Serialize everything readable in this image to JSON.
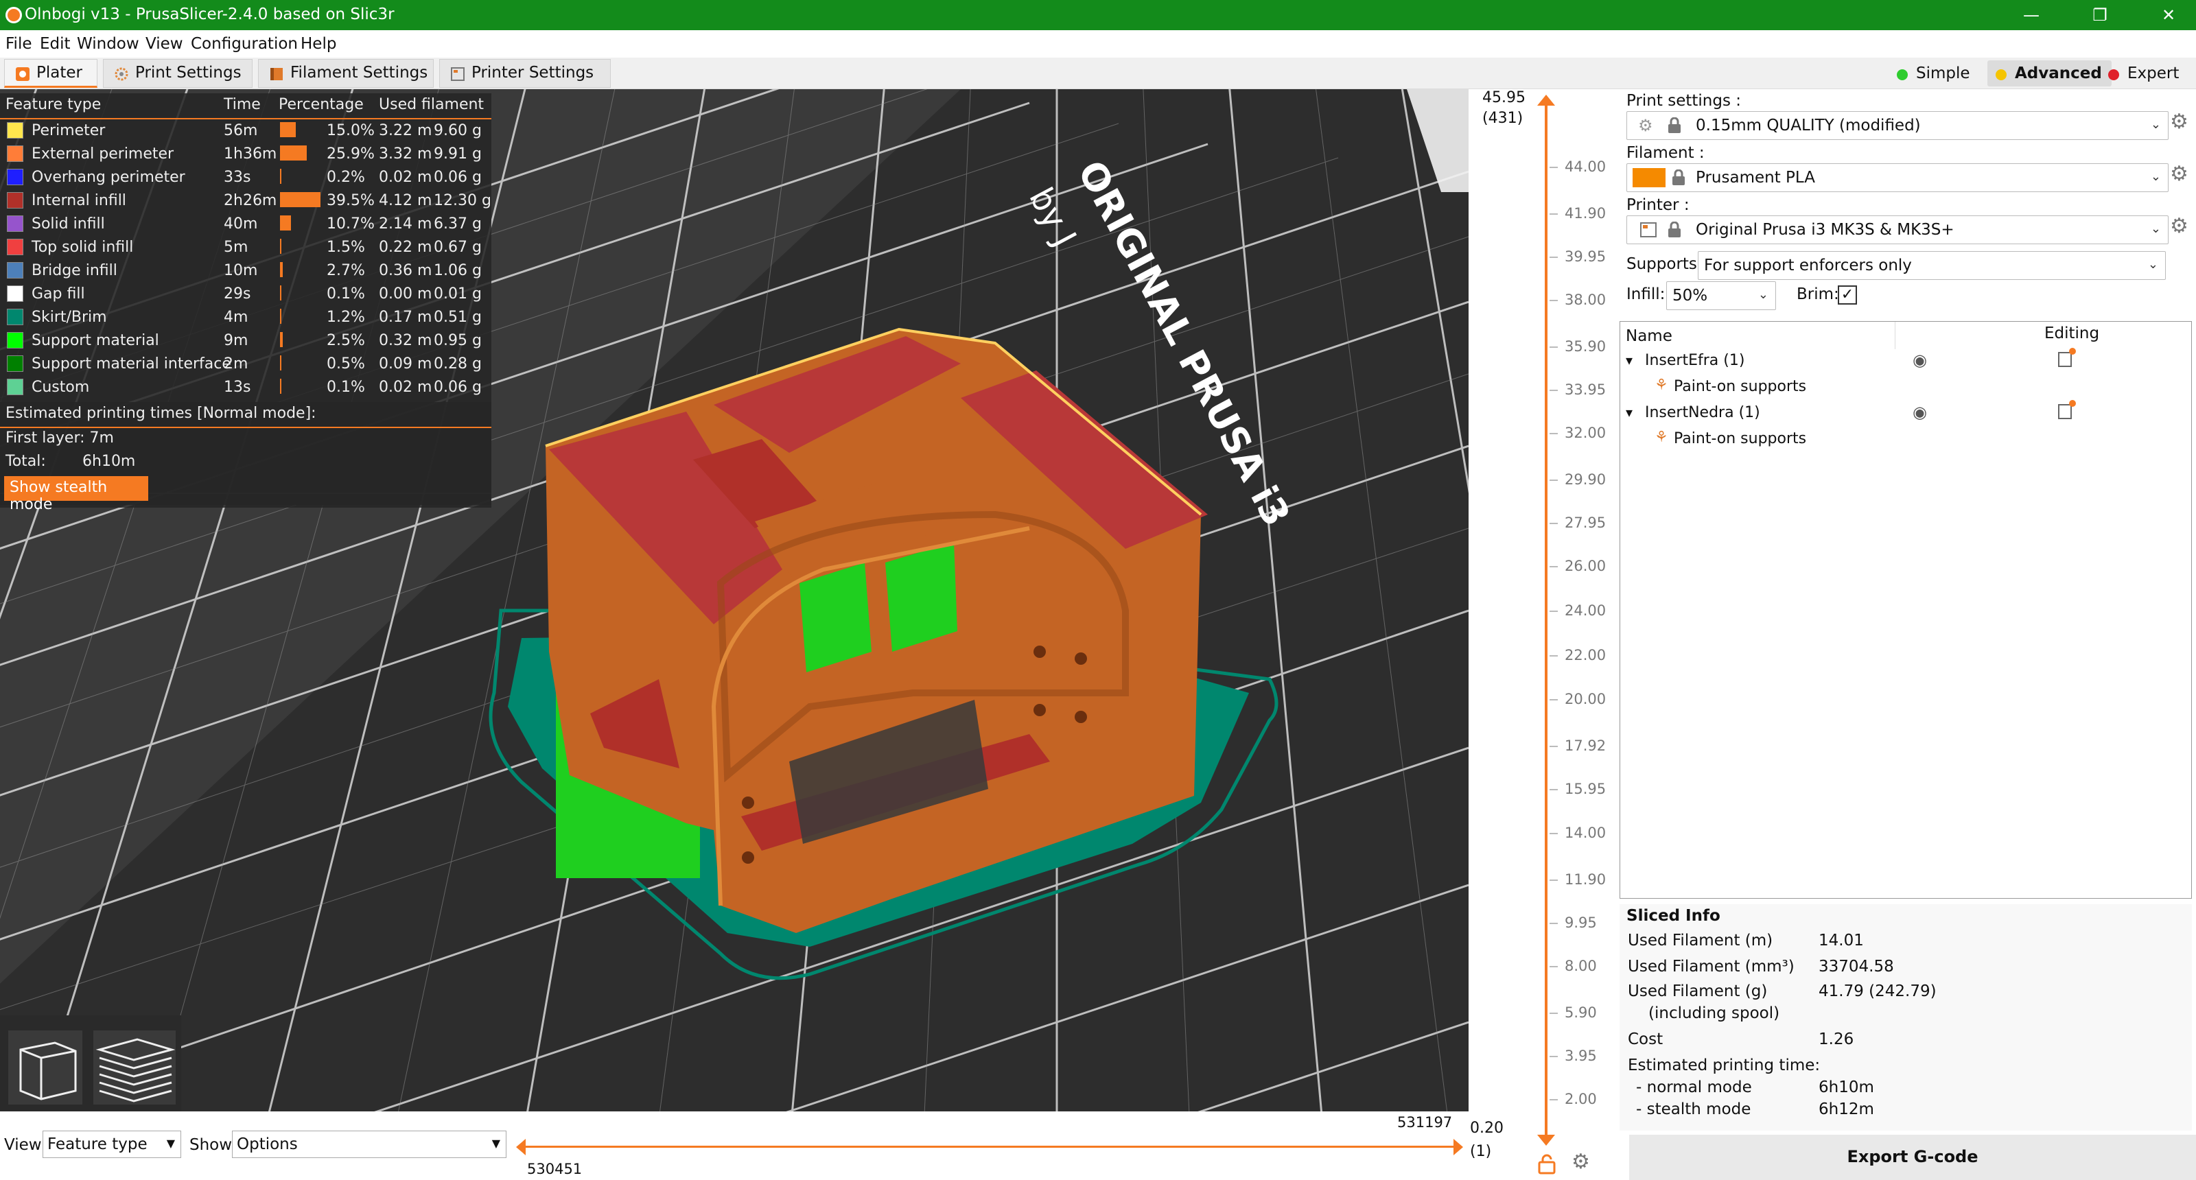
{
  "window": {
    "title": "Olnbogi v13 - PrusaSlicer-2.4.0 based on Slic3r",
    "minimize": "—",
    "restore": "❐",
    "close": "✕"
  },
  "menu": [
    "File",
    "Edit",
    "Window",
    "View",
    "Configuration",
    "Help"
  ],
  "tabs": [
    "Plater",
    "Print Settings",
    "Filament Settings",
    "Printer Settings"
  ],
  "modes": [
    {
      "label": "Simple",
      "color": "#2ecc2e"
    },
    {
      "label": "Advanced",
      "color": "#f5c400"
    },
    {
      "label": "Expert",
      "color": "#e0202a"
    }
  ],
  "legend": {
    "headers": [
      "Feature type",
      "Time",
      "Percentage",
      "Used filament"
    ],
    "rows": [
      {
        "name": "Perimeter",
        "color": "#ffe64d",
        "time": "56m",
        "pct": "15.0%",
        "pctv": 15.0,
        "len": "3.22 m",
        "wt": "9.60 g"
      },
      {
        "name": "External perimeter",
        "color": "#ff7d38",
        "time": "1h36m",
        "pct": "25.9%",
        "pctv": 25.9,
        "len": "3.32 m",
        "wt": "9.91 g"
      },
      {
        "name": "Overhang perimeter",
        "color": "#1f1fff",
        "time": "33s",
        "pct": "0.2%",
        "pctv": 0.2,
        "len": "0.02 m",
        "wt": "0.06 g"
      },
      {
        "name": "Internal infill",
        "color": "#b03029",
        "time": "2h26m",
        "pct": "39.5%",
        "pctv": 39.5,
        "len": "4.12 m",
        "wt": "12.30 g"
      },
      {
        "name": "Solid infill",
        "color": "#9654cc",
        "time": "40m",
        "pct": "10.7%",
        "pctv": 10.7,
        "len": "2.14 m",
        "wt": "6.37 g"
      },
      {
        "name": "Top solid infill",
        "color": "#f04040",
        "time": "5m",
        "pct": "1.5%",
        "pctv": 1.5,
        "len": "0.22 m",
        "wt": "0.67 g"
      },
      {
        "name": "Bridge infill",
        "color": "#4d80ba",
        "time": "10m",
        "pct": "2.7%",
        "pctv": 2.7,
        "len": "0.36 m",
        "wt": "1.06 g"
      },
      {
        "name": "Gap fill",
        "color": "#ffffff",
        "time": "29s",
        "pct": "0.1%",
        "pctv": 0.1,
        "len": "0.00 m",
        "wt": "0.01 g"
      },
      {
        "name": "Skirt/Brim",
        "color": "#00876e",
        "time": "4m",
        "pct": "1.2%",
        "pctv": 1.2,
        "len": "0.17 m",
        "wt": "0.51 g"
      },
      {
        "name": "Support material",
        "color": "#00ff00",
        "time": "9m",
        "pct": "2.5%",
        "pctv": 2.5,
        "len": "0.32 m",
        "wt": "0.95 g"
      },
      {
        "name": "Support material interface",
        "color": "#008000",
        "time": "2m",
        "pct": "0.5%",
        "pctv": 0.5,
        "len": "0.09 m",
        "wt": "0.28 g"
      },
      {
        "name": "Custom",
        "color": "#5ed194",
        "time": "13s",
        "pct": "0.1%",
        "pctv": 0.1,
        "len": "0.02 m",
        "wt": "0.06 g"
      }
    ],
    "est_title": "Estimated printing times [Normal mode]:",
    "first_layer": "First layer: 7m",
    "total_label": "Total:",
    "total_value": "6h10m",
    "stealth_btn": "Show stealth mode"
  },
  "bed_label": "ORIGINAL PRUSA i3",
  "bed_label2": "by J",
  "view": {
    "view_label": "View",
    "view_value": "Feature type",
    "show_label": "Show",
    "show_value": "Options",
    "hslider_top": "531197",
    "hslider_bottom": "530451"
  },
  "vslider": {
    "top_value": "45.95",
    "top_layer": "(431)",
    "bottom_value": "0.20",
    "bottom_layer": "(1)",
    "ticks": [
      "44.00",
      "41.90",
      "39.95",
      "38.00",
      "35.90",
      "33.95",
      "32.00",
      "29.90",
      "27.95",
      "26.00",
      "24.00",
      "22.00",
      "20.00",
      "17.92",
      "15.95",
      "14.00",
      "11.90",
      "9.95",
      "8.00",
      "5.90",
      "3.95",
      "2.00"
    ]
  },
  "right": {
    "print_label": "Print settings :",
    "print_value": "0.15mm QUALITY (modified)",
    "filament_label": "Filament :",
    "filament_value": "Prusament PLA",
    "filament_color": "#f58a00",
    "printer_label": "Printer :",
    "printer_value": "Original Prusa i3 MK3S & MK3S+",
    "supports_label": "Supports:",
    "supports_value": "For support enforcers only",
    "infill_label": "Infill:",
    "infill_value": "50%",
    "brim_label": "Brim:",
    "list_name": "Name",
    "list_editing": "Editing",
    "objects": [
      {
        "name": "InsertEfra (1)",
        "child": "Paint-on supports"
      },
      {
        "name": "InsertNedra (1)",
        "child": "Paint-on supports"
      }
    ]
  },
  "sliced": {
    "title": "Sliced Info",
    "rows": [
      {
        "k": "Used Filament (m)",
        "v": "14.01"
      },
      {
        "k": "Used Filament (mm³)",
        "v": "33704.58"
      },
      {
        "k": "Used Filament (g)",
        "v": "41.79 (242.79)"
      },
      {
        "k": "(including spool)",
        "v": ""
      },
      {
        "k": "Cost",
        "v": "1.26"
      },
      {
        "k": "Estimated printing time:",
        "v": ""
      },
      {
        "k": "- normal mode",
        "v": "6h10m"
      },
      {
        "k": "- stealth mode",
        "v": "6h12m"
      }
    ]
  },
  "export_btn": "Export G-code"
}
